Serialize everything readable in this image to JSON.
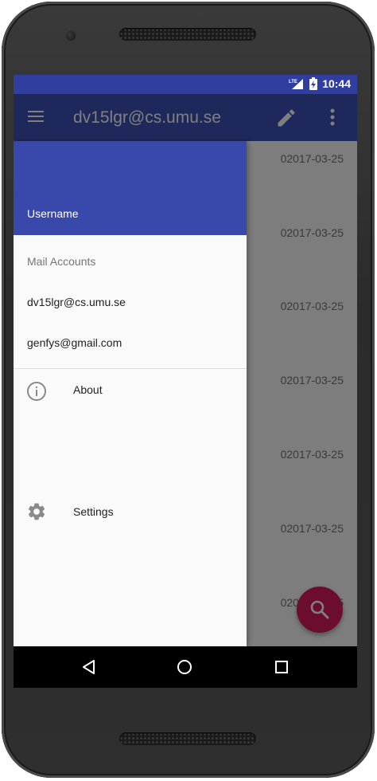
{
  "status_bar": {
    "network": "LTE",
    "time": "10:44"
  },
  "app_bar": {
    "title": "dv15lgr@cs.umu.se",
    "icons": [
      "menu-icon",
      "pencil-icon",
      "overflow-menu-icon"
    ]
  },
  "email_list": {
    "dates": [
      "02017-03-25",
      "02017-03-25",
      "02017-03-25",
      "02017-03-25",
      "02017-03-25",
      "02017-03-25",
      "02017-03-25"
    ]
  },
  "fab": {
    "icon": "search-icon"
  },
  "drawer": {
    "username": "Username",
    "subheader": "Mail Accounts",
    "accounts": [
      "dv15lgr@cs.umu.se",
      "genfys@gmail.com"
    ],
    "menu": [
      {
        "label": "About",
        "icon": "info-icon"
      },
      {
        "label": "Settings",
        "icon": "gear-icon"
      }
    ]
  },
  "nav_bar": {
    "icons": [
      "back-icon",
      "home-icon",
      "recents-icon"
    ]
  },
  "colors": {
    "status_bar": "#303f9f",
    "app_bar": "#3f51b5",
    "drawer_header": "#3949ab",
    "fab": "#d81b60"
  }
}
